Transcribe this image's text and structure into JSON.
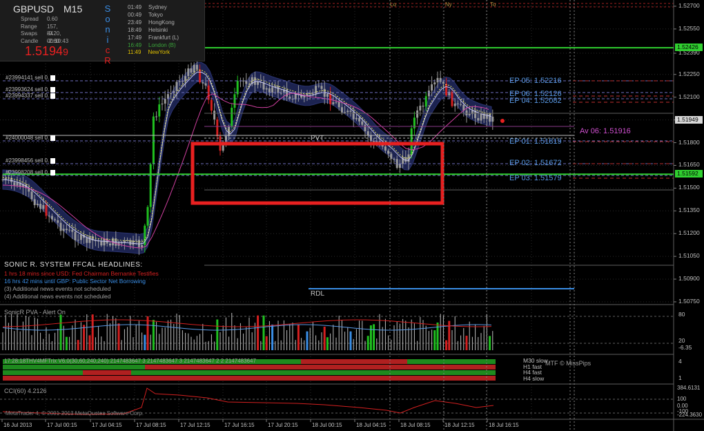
{
  "symbol": "GBPUSD",
  "timeframe": "M15",
  "info_panel": {
    "spread_label": "Spread",
    "spread_value": "0.60",
    "range_label": "Range",
    "range_value": "157, 84",
    "swaps_label": "Swaps",
    "swaps_value": "-0.20, -2.60",
    "candle_label": "Candle",
    "candle_value": "00:10:43",
    "price_main": "1.5194",
    "price_last_digit": "9",
    "sonic_letters": [
      "S",
      "o",
      "n",
      "i",
      "c",
      "R"
    ]
  },
  "sessions": [
    {
      "time": "01:49",
      "name": "Sydney",
      "color": "#b0b0b0"
    },
    {
      "time": "00:49",
      "name": "Tokyo",
      "color": "#b0b0b0"
    },
    {
      "time": "23:49",
      "name": "HongKong",
      "color": "#b0b0b0"
    },
    {
      "time": "18:49",
      "name": "Helsinki",
      "color": "#b0b0b0"
    },
    {
      "time": "17:49",
      "name": "Frankfurt  (L)",
      "color": "#b0b0b0"
    },
    {
      "time": "16:49",
      "name": "London  (B)",
      "color": "#3aa53a"
    },
    {
      "time": "11:49",
      "name": "NewYork",
      "color": "#e0c000"
    }
  ],
  "top_session_marks": [
    "Lo",
    "Ny",
    "To"
  ],
  "price_axis": {
    "ticks": [
      "1.52700",
      "1.52550",
      "1.52390",
      "1.52250",
      "1.52100",
      "1.51950",
      "1.51800",
      "1.51650",
      "1.51500",
      "1.51350",
      "1.51200",
      "1.51050",
      "1.50900",
      "1.50750"
    ],
    "highlight_high": "1.52426",
    "highlight_current": "1.51949",
    "highlight_low": "1.51592"
  },
  "orders": [
    {
      "label": "#23994141 sell 0."
    },
    {
      "label": "#23993624 sell 0."
    },
    {
      "label": "#23994337 sell 0."
    },
    {
      "label": "#24000048 sell 0."
    },
    {
      "label": "#23998456 sell 0."
    },
    {
      "label": "#23998208 sell 0."
    }
  ],
  "ep_labels": [
    {
      "text": "EP 05:  1.52216"
    },
    {
      "text": "EP 06:  1.52126"
    },
    {
      "text": "EP 04:  1.52082"
    },
    {
      "text": "EP 01:  1.51819"
    },
    {
      "text": "EP 02:  1.51672"
    },
    {
      "text": "EP 03:  1.51579"
    }
  ],
  "av_label": "Av 06:  1.51916",
  "pvt_label": "PVT",
  "rdl_label": "RDL",
  "headlines": {
    "title": "SONIC R. SYSTEM  FFCAL HEADLINES:",
    "lines": [
      {
        "text": "1 hrs 18 mins since USD: Fed Chairman Bernanke Testifies",
        "color": "#d42020"
      },
      {
        "text": "16 hrs 42 mins until GBP: Public Sector Net Borrowing",
        "color": "#3a8ee6"
      },
      {
        "text": "(3)  Additional news events not scheduled",
        "color": "#a0a0a0"
      },
      {
        "text": "(4)  Additional news events not scheduled",
        "color": "#a0a0a0"
      }
    ]
  },
  "pva_panel": {
    "title": "SonicR PVA - Alert On",
    "axis": [
      "80",
      "20",
      "-6.35"
    ]
  },
  "mtf_panel": {
    "title": "17:28:18THV4MFTrix V6.0(30,60,240,240) 2147483647 3 2147483647 3 2147483647 2 2 2147483647",
    "labels": [
      "M30 slow",
      "H1 fast",
      "H4 fast",
      "H4 slow"
    ],
    "credit": "MTF © MissPips",
    "axis": [
      "4",
      "1"
    ]
  },
  "cci_panel": {
    "title": "CCI(60) 4.2126",
    "axis": [
      "384.6131",
      "100",
      "0.00",
      "-100",
      "-224.3630"
    ],
    "copyright": "MetaTrader 4, © 2001-2013 MetaQuotes Software Corp."
  },
  "time_axis": [
    "16 Jul 2013",
    "17 Jul 00:15",
    "17 Jul 04:15",
    "17 Jul 08:15",
    "17 Jul 12:15",
    "17 Jul 16:15",
    "17 Jul 20:15",
    "18 Jul 00:15",
    "18 Jul 04:15",
    "18 Jul 08:15",
    "18 Jul 12:15",
    "18 Jul 16:15"
  ],
  "colors": {
    "bull": "#20c020",
    "bear": "#d42020",
    "neutral": "#9a9a9a",
    "ep_text": "#5a9ae6",
    "av_text": "#d050d0",
    "highlight_box": "#e82020",
    "green_line": "#30d030"
  }
}
